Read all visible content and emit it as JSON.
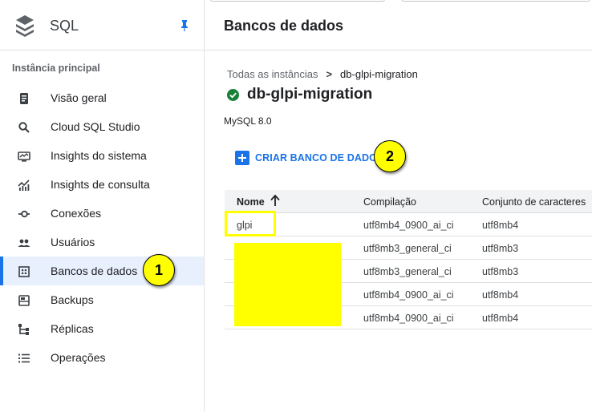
{
  "sidebar": {
    "product": "SQL",
    "section_title": "Instância principal",
    "items": [
      {
        "label": "Visão geral",
        "icon": "overview-icon"
      },
      {
        "label": "Cloud SQL Studio",
        "icon": "search-icon"
      },
      {
        "label": "Insights do sistema",
        "icon": "system-insights-icon"
      },
      {
        "label": "Insights de consulta",
        "icon": "query-insights-icon"
      },
      {
        "label": "Conexões",
        "icon": "connections-icon"
      },
      {
        "label": "Usuários",
        "icon": "users-icon"
      },
      {
        "label": "Bancos de dados",
        "icon": "databases-icon",
        "active": true
      },
      {
        "label": "Backups",
        "icon": "backups-icon"
      },
      {
        "label": "Réplicas",
        "icon": "replicas-icon"
      },
      {
        "label": "Operações",
        "icon": "operations-icon"
      }
    ]
  },
  "header": {
    "title": "Bancos de dados"
  },
  "breadcrumb": {
    "parent": "Todas as instâncias",
    "separator": ">",
    "current": "db-glpi-migration"
  },
  "instance": {
    "name": "db-glpi-migration",
    "status": "running",
    "version": "MySQL 8.0"
  },
  "actions": {
    "create_label": "CRIAR BANCO DE DADOS"
  },
  "table": {
    "columns": [
      "Nome",
      "Compilação",
      "Conjunto de caracteres"
    ],
    "sort": "ascending",
    "rows": [
      {
        "name": "glpi",
        "collation": "utf8mb4_0900_ai_ci",
        "charset": "utf8mb4"
      },
      {
        "name": "",
        "collation": "utf8mb3_general_ci",
        "charset": "utf8mb3"
      },
      {
        "name": "",
        "collation": "utf8mb3_general_ci",
        "charset": "utf8mb3"
      },
      {
        "name": "",
        "collation": "utf8mb4_0900_ai_ci",
        "charset": "utf8mb4"
      },
      {
        "name": "",
        "collation": "utf8mb4_0900_ai_ci",
        "charset": "utf8mb4"
      }
    ]
  },
  "annotations": {
    "step1": "1",
    "step2": "2",
    "color": "#ffff00"
  },
  "colors": {
    "accent": "#1a73e8",
    "status_ok": "#188038",
    "active_bg": "#e8f0fe"
  }
}
